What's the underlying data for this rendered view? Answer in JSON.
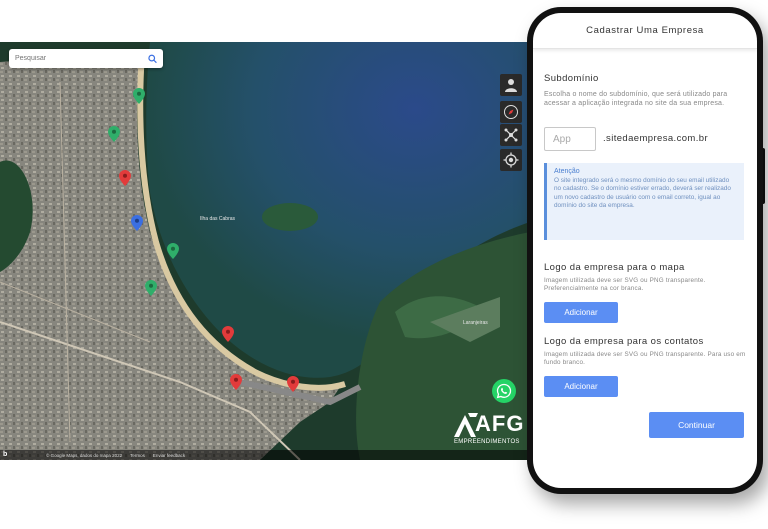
{
  "map": {
    "search_placeholder": "Pesquisar",
    "place_label": "Ilha das Cabras",
    "place_label_2": "Laranjeiras",
    "footer": {
      "brand": "b",
      "attribution": "© Google Maps, dados do mapa 2022",
      "terms": "Termos",
      "feedback": "Enviar feedback"
    },
    "controls": [
      "person-icon",
      "compass-icon",
      "drone-icon",
      "locate-icon"
    ],
    "pin_colors": {
      "green": "#2fae6a",
      "red": "#e23b3b",
      "blue": "#3b6fe2"
    }
  },
  "logo": {
    "name": "AFG",
    "subtitle": "EMPREENDIMENTOS"
  },
  "phone": {
    "header_title": "Cadastrar Uma Empresa",
    "subdomain": {
      "title": "Subdomínio",
      "description": "Escolha o nome do subdomínio, que será utilizado para acessar a aplicação integrada no site da sua empresa.",
      "input_placeholder": "App",
      "domain_suffix": ".sitedaempresa.com.br"
    },
    "alert": {
      "title": "Atenção",
      "body": "O site integrado será o mesmo domínio do seu email utilizado no cadastro. Se o domínio estiver errado, deverá ser realizado um novo cadastro de usuário com o email correto, igual ao domínio do site da empresa."
    },
    "logo_map": {
      "title": "Logo da empresa para o mapa",
      "description": "Imagem utilizada deve ser SVG ou PNG transparente. Preferencialmente na cor branca.",
      "button": "Adicionar"
    },
    "logo_contacts": {
      "title": "Logo da empresa para os contatos",
      "description": "Imagem utilizada deve ser SVG ou PNG transparente. Para uso em fundo branco.",
      "button": "Adicionar"
    },
    "continue_button": "Continuar"
  },
  "colors": {
    "accent": "#5b8ef3",
    "alert_bg": "#eaf1fb",
    "alert_text": "#4a7fd0",
    "whatsapp": "#25d366"
  }
}
